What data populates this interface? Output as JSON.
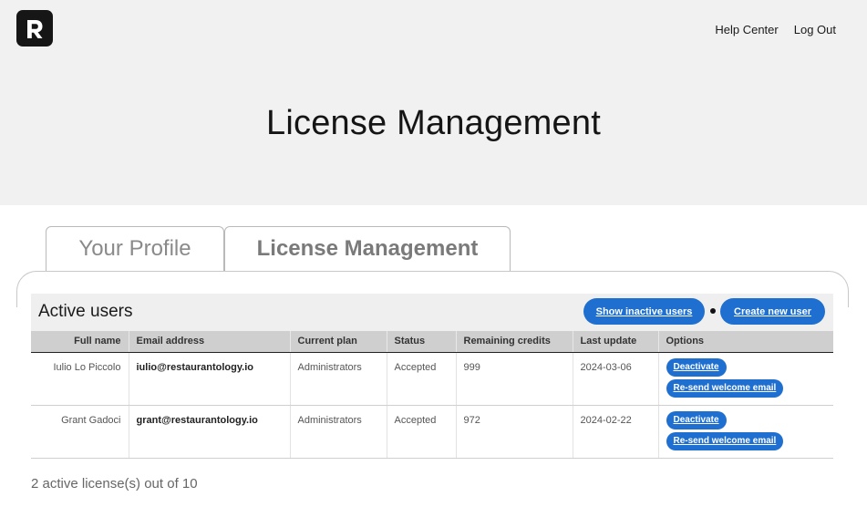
{
  "header": {
    "logo_letter": "R",
    "nav": {
      "help": "Help Center",
      "logout": "Log Out"
    },
    "title": "License Management"
  },
  "tabs": [
    {
      "label": "Your Profile"
    },
    {
      "label": "License Management"
    }
  ],
  "users": {
    "title": "Active users",
    "show_inactive_label": "Show inactive users",
    "create_label": "Create new user",
    "columns": [
      "Full name",
      "Email address",
      "Current plan",
      "Status",
      "Remaining credits",
      "Last update",
      "Options"
    ],
    "rows": [
      {
        "name": "Iulio Lo Piccolo",
        "email": "iulio@restaurantology.io",
        "plan": "Administrators",
        "status": "Accepted",
        "credits": "999",
        "updated": "2024-03-06",
        "deactivate": "Deactivate",
        "resend": "Re-send welcome email"
      },
      {
        "name": "Grant Gadoci",
        "email": "grant@restaurantology.io",
        "plan": "Administrators",
        "status": "Accepted",
        "credits": "972",
        "updated": "2024-02-22",
        "deactivate": "Deactivate",
        "resend": "Re-send welcome email"
      }
    ],
    "license_count": "2 active license(s) out of 10"
  },
  "colors": {
    "accent": "#1e6fd0",
    "hero_bg": "#f1f1f1",
    "logo_bg": "#161616"
  }
}
